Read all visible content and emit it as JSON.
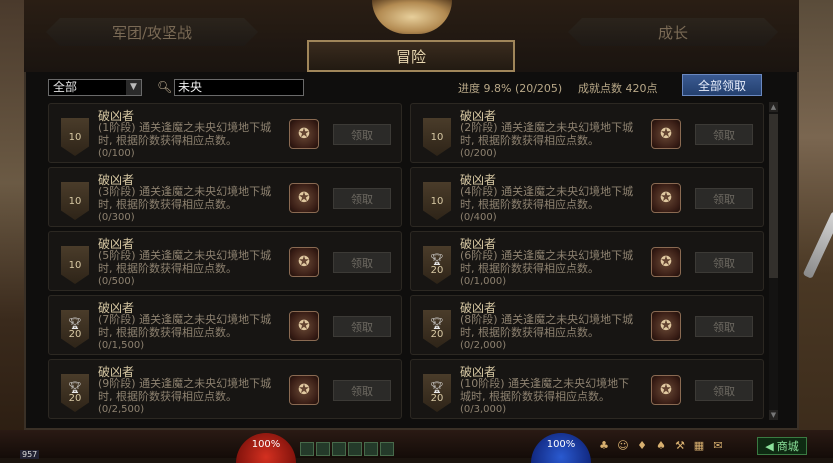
{
  "tabs": {
    "left": "军团/攻坚战",
    "active": "冒险",
    "right": "成长"
  },
  "filter": {
    "category": "全部",
    "search_value": "未央"
  },
  "summary": {
    "progress": "进度  9.8% (20/205)",
    "points": "成就点数 420点",
    "claim_all": "全部领取"
  },
  "achievements": [
    {
      "title": "破凶者",
      "desc": "(1阶段) 通关逢魔之未央幻境地下城时, 根据阶数获得相应点数。",
      "progress": "(0/100)",
      "points": "10",
      "trophy": false,
      "claim": "领取"
    },
    {
      "title": "破凶者",
      "desc": "(2阶段) 通关逢魔之未央幻境地下城时, 根据阶数获得相应点数。",
      "progress": "(0/200)",
      "points": "10",
      "trophy": false,
      "claim": "领取"
    },
    {
      "title": "破凶者",
      "desc": "(3阶段) 通关逢魔之未央幻境地下城时, 根据阶数获得相应点数。",
      "progress": "(0/300)",
      "points": "10",
      "trophy": false,
      "claim": "领取"
    },
    {
      "title": "破凶者",
      "desc": "(4阶段) 通关逢魔之未央幻境地下城时, 根据阶数获得相应点数。",
      "progress": "(0/400)",
      "points": "10",
      "trophy": false,
      "claim": "领取"
    },
    {
      "title": "破凶者",
      "desc": "(5阶段) 通关逢魔之未央幻境地下城时, 根据阶数获得相应点数。",
      "progress": "(0/500)",
      "points": "10",
      "trophy": false,
      "claim": "领取"
    },
    {
      "title": "破凶者",
      "desc": "(6阶段) 通关逢魔之未央幻境地下城时, 根据阶数获得相应点数。",
      "progress": "(0/1,000)",
      "points": "20",
      "trophy": true,
      "claim": "领取"
    },
    {
      "title": "破凶者",
      "desc": "(7阶段) 通关逢魔之未央幻境地下城时, 根据阶数获得相应点数。",
      "progress": "(0/1,500)",
      "points": "20",
      "trophy": true,
      "claim": "领取"
    },
    {
      "title": "破凶者",
      "desc": "(8阶段) 通关逢魔之未央幻境地下城时, 根据阶数获得相应点数。",
      "progress": "(0/2,000)",
      "points": "20",
      "trophy": true,
      "claim": "领取"
    },
    {
      "title": "破凶者",
      "desc": "(9阶段) 通关逢魔之未央幻境地下城时, 根据阶数获得相应点数。",
      "progress": "(0/2,500)",
      "points": "20",
      "trophy": true,
      "claim": "领取"
    },
    {
      "title": "破凶者",
      "desc": "(10阶段) 通关逢魔之未央幻境地下城时, 根据阶数获得相应点数。",
      "progress": "(0/3,000)",
      "points": "20",
      "trophy": true,
      "claim": "领取"
    }
  ],
  "hud": {
    "hp": "100%",
    "mp": "100%",
    "level": "957",
    "shop": "商城"
  }
}
